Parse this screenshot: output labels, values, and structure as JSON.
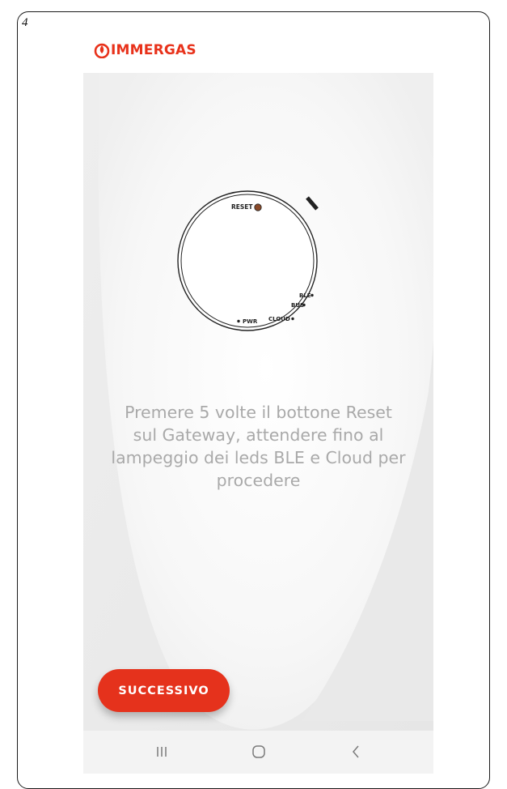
{
  "page_number": "4",
  "brand": {
    "name": "IMMERGAS",
    "color": "#e8321b"
  },
  "device": {
    "reset_label": "RESET",
    "led_labels": {
      "ble": "BLE",
      "bus": "BUS",
      "pwr": "PWR",
      "cloud": "CLOUD"
    }
  },
  "instruction": {
    "lines": [
      "Premere 5 volte il bottone Reset",
      "sul Gateway, attendere fino al",
      "lampeggio dei leds BLE e Cloud per",
      "procedere"
    ]
  },
  "next_button": {
    "label": "SUCCESSIVO",
    "color": "#e5321c"
  },
  "nav_bar": {
    "recents_icon": "recents-icon",
    "home_icon": "home-icon",
    "back_icon": "back-icon"
  }
}
